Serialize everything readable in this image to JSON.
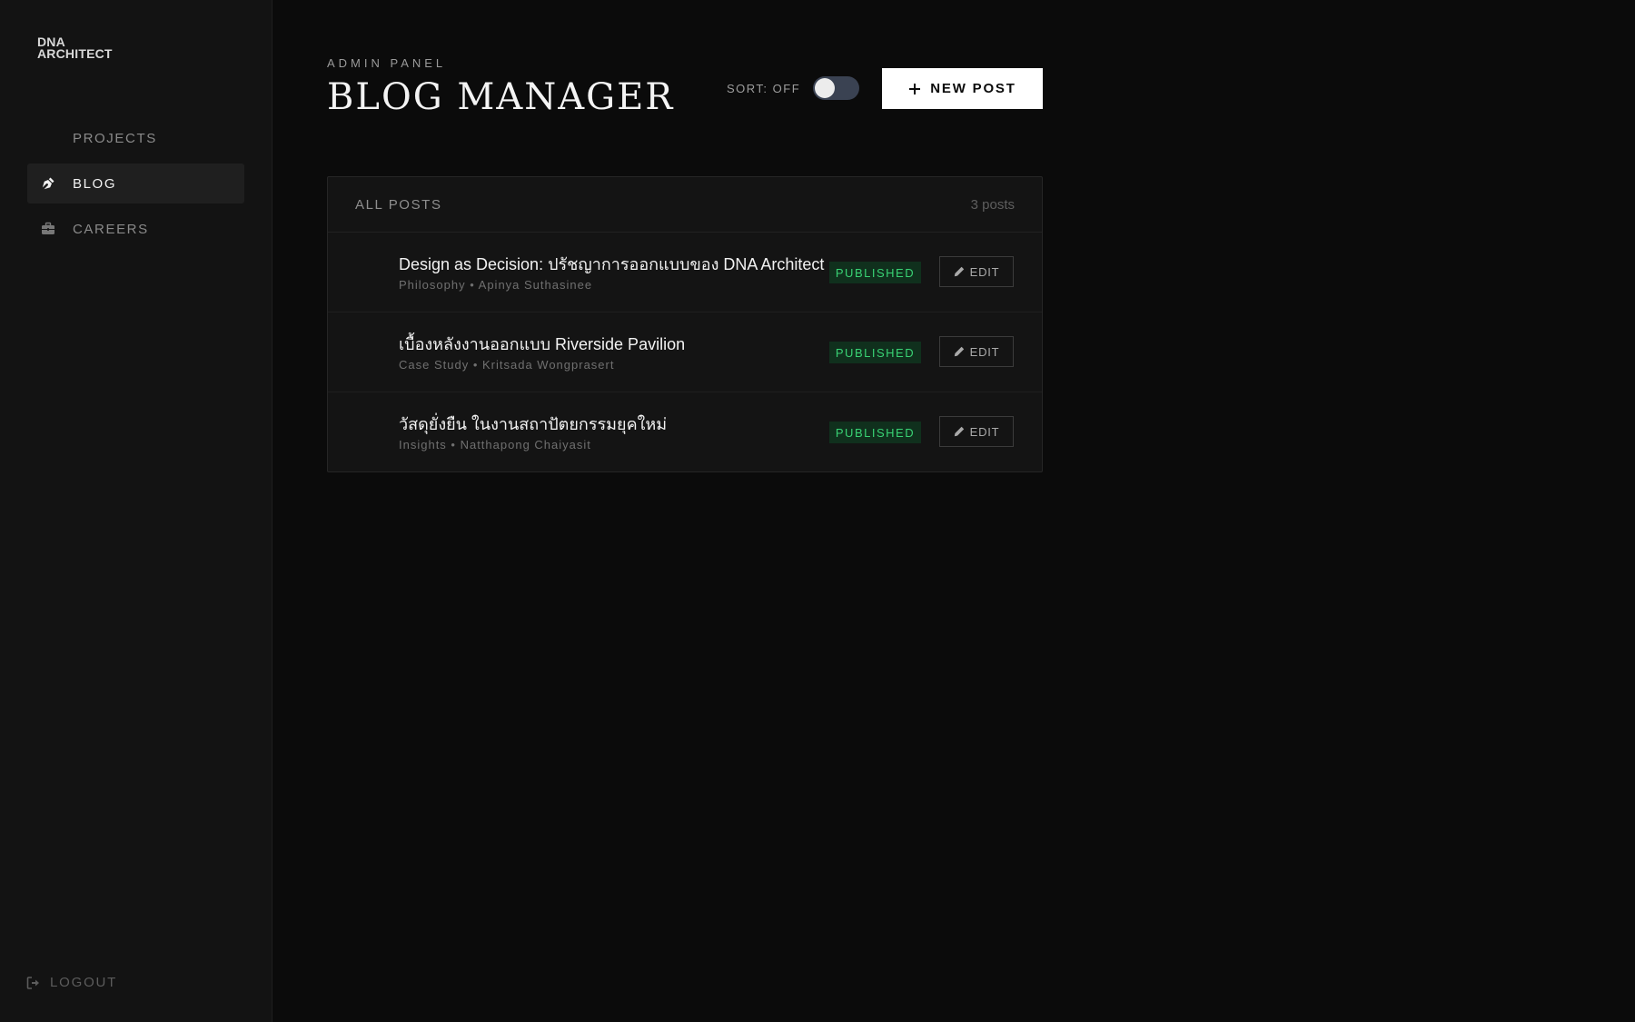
{
  "sidebar": {
    "logo_line1": "DNA",
    "logo_line2": "ARCHITECT",
    "items": [
      {
        "label": "PROJECTS",
        "icon": "grid-icon"
      },
      {
        "label": "BLOG",
        "icon": "pen-nib-icon",
        "active": true
      },
      {
        "label": "CAREERS",
        "icon": "briefcase-icon"
      }
    ],
    "logout_label": "LOGOUT"
  },
  "header": {
    "eyebrow": "ADMIN PANEL",
    "title": "BLOG MANAGER",
    "sort_label": "SORT: OFF",
    "sort_on": false,
    "new_post_label": "NEW POST"
  },
  "panel": {
    "title": "ALL POSTS",
    "count": "3 posts",
    "posts": [
      {
        "title": "Design as Decision: ปรัชญาการออกแบบของ DNA Architect",
        "meta": "Philosophy • Apinya Suthasinee",
        "status": "PUBLISHED",
        "edit_label": "EDIT"
      },
      {
        "title": "เบื้องหลังงานออกแบบ Riverside Pavilion",
        "meta": "Case Study • Kritsada Wongprasert",
        "status": "PUBLISHED",
        "edit_label": "EDIT"
      },
      {
        "title": "วัสดุยั่งยืน ในงานสถาปัตยกรรมยุคใหม่",
        "meta": "Insights • Natthapong Chaiyasit",
        "status": "PUBLISHED",
        "edit_label": "EDIT"
      }
    ]
  },
  "colors": {
    "background": "#0b0b0b",
    "sidebar": "#131313",
    "published_text": "#39d274",
    "published_bg": "#10301d",
    "toggle_track": "#3a4252"
  }
}
